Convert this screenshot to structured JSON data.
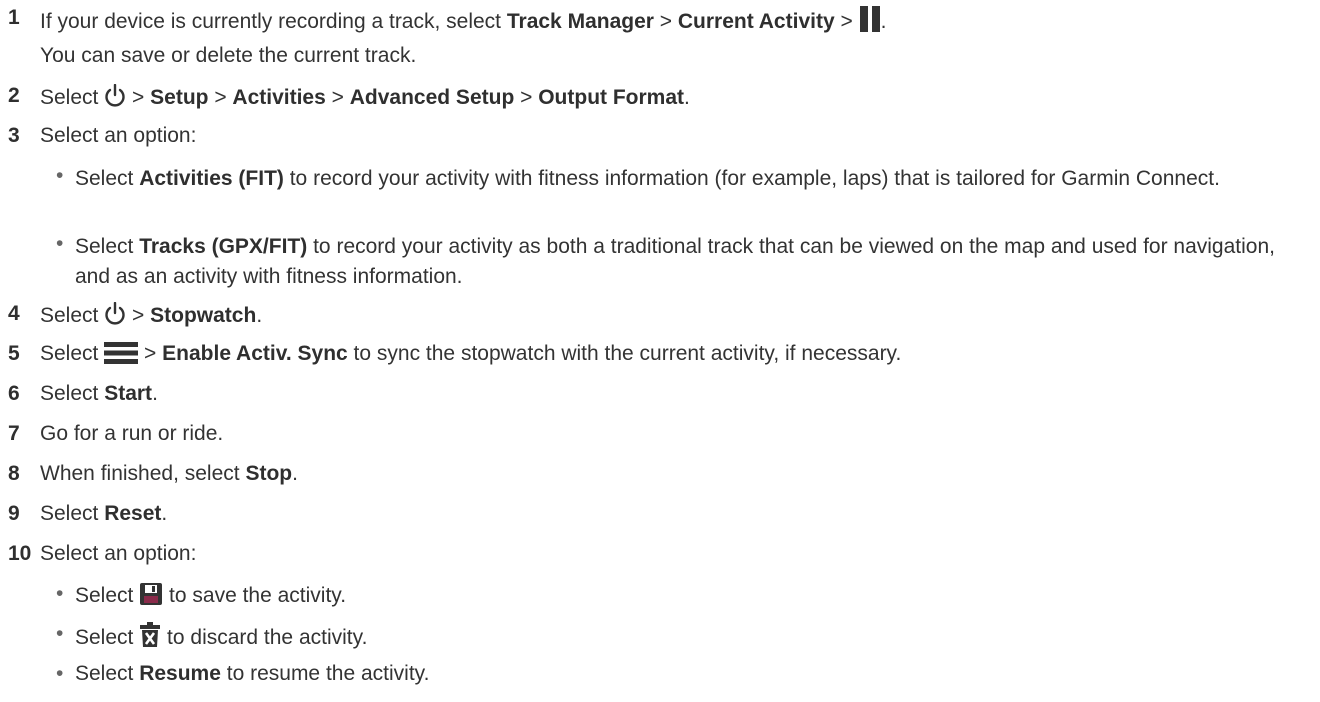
{
  "steps": [
    {
      "num": "1",
      "pre": "If your device is currently recording a track, select ",
      "b1": "Track Manager",
      "sep1": " > ",
      "b2": "Current Activity",
      "sep2": " > ",
      "post": ".",
      "note": "You can save or delete the current track."
    },
    {
      "num": "2",
      "pre": "Select ",
      "sep0": " > ",
      "b1": "Setup",
      "sep1": " > ",
      "b2": "Activities",
      "sep2": " > ",
      "b3": "Advanced Setup",
      "sep3": " > ",
      "b4": "Output Format",
      "post": "."
    },
    {
      "num": "3",
      "text": "Select an option:"
    },
    {
      "num": "4",
      "pre": "Select ",
      "sep0": " > ",
      "b1": "Stopwatch",
      "post": "."
    },
    {
      "num": "5",
      "pre": "Select ",
      "sep0": " > ",
      "b1": "Enable Activ. Sync",
      "post": " to sync the stopwatch with the current activity, if necessary."
    },
    {
      "num": "6",
      "pre": "Select ",
      "b1": "Start",
      "post": "."
    },
    {
      "num": "7",
      "text": "Go for a run or ride."
    },
    {
      "num": "8",
      "pre": "When finished, select ",
      "b1": "Stop",
      "post": "."
    },
    {
      "num": "9",
      "pre": "Select ",
      "b1": "Reset",
      "post": "."
    },
    {
      "num": "10",
      "text": "Select an option:"
    }
  ],
  "options3": [
    {
      "bullet": "•",
      "pre": "Select ",
      "b1": "Activities (FIT)",
      "post": " to record your activity with fitness information (for example, laps) that is tailored for Garmin Connect."
    },
    {
      "bullet": "•",
      "pre": "Select ",
      "b1": "Tracks (GPX/FIT)",
      "post": " to record your activity as both a traditional track that can be viewed on the map and used for navigation, and as an activity with fitness information."
    }
  ],
  "options10": [
    {
      "bullet": "•",
      "pre": "Select ",
      "post": " to save the activity."
    },
    {
      "bullet": "•",
      "pre": "Select ",
      "post": " to discard the activity."
    },
    {
      "bullet": "•",
      "pre": "Select ",
      "b1": "Resume",
      "post": " to resume the activity."
    }
  ],
  "icons": {
    "pause": "pause-icon",
    "power": "power-icon",
    "menu": "menu-icon",
    "save": "save-icon",
    "discard": "discard-icon"
  },
  "colors": {
    "text": "#333333",
    "icon": "#333333",
    "icon_save": "#8a2b4a"
  }
}
